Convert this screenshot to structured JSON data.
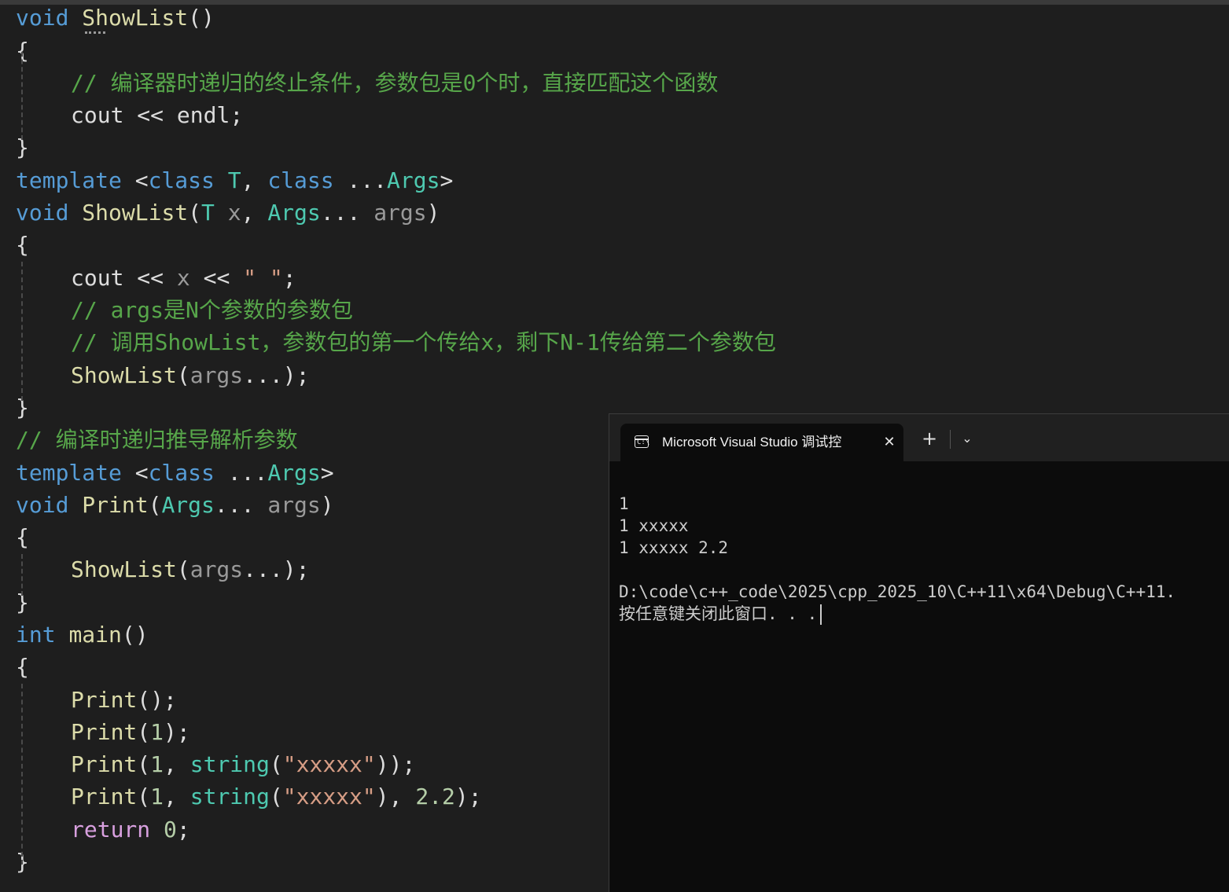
{
  "editor": {
    "lines": [
      [
        "void",
        " ",
        "ShowList",
        "()"
      ],
      [
        "{"
      ],
      [
        "// 编译器时递归的终止条件，参数包是0个时，直接匹配这个函数"
      ],
      [
        "cout",
        " << ",
        "endl",
        ";"
      ],
      [
        "}"
      ],
      [
        "template",
        " <",
        "class",
        " ",
        "T",
        ", ",
        "class",
        " ...",
        "Args",
        ">"
      ],
      [
        "void",
        " ",
        "ShowList",
        "(",
        "T",
        " ",
        "x",
        ", ",
        "Args",
        "... ",
        "args",
        ")"
      ],
      [
        "{"
      ],
      [
        "cout",
        " << ",
        "x",
        " << ",
        "\" \"",
        ";"
      ],
      [
        "// args是N个参数的参数包"
      ],
      [
        "// 调用ShowList，参数包的第一个传给x，剩下N-1传给第二个参数包"
      ],
      [
        "ShowList",
        "(",
        "args",
        "...",
        ");"
      ],
      [
        "}"
      ],
      [
        "// 编译时递归推导解析参数"
      ],
      [
        "template",
        " <",
        "class",
        " ...",
        "Args",
        ">"
      ],
      [
        "void",
        " ",
        "Print",
        "(",
        "Args",
        "... ",
        "args",
        ")"
      ],
      [
        "{"
      ],
      [
        "ShowList",
        "(",
        "args",
        "...",
        ");"
      ],
      [
        "}"
      ],
      [
        "int",
        " ",
        "main",
        "()"
      ],
      [
        "{"
      ],
      [
        "Print",
        "();"
      ],
      [
        "Print",
        "(",
        "1",
        ");"
      ],
      [
        "Print",
        "(",
        "1",
        ", ",
        "string",
        "(",
        "\"xxxxx\"",
        "));"
      ],
      [
        "Print",
        "(",
        "1",
        ", ",
        "string",
        "(",
        "\"xxxxx\"",
        "), ",
        "2.2",
        ");"
      ],
      [
        "return",
        " ",
        "0",
        ";"
      ],
      [
        "}"
      ]
    ]
  },
  "terminal": {
    "tab_title": "Microsoft Visual Studio 调试控",
    "tab_icon_glyph": "C:\\",
    "close_glyph": "✕",
    "new_tab_glyph": "+",
    "dropdown_glyph": "⌄",
    "output": [
      "1",
      "1 xxxxx",
      "1 xxxxx 2.2",
      "",
      "D:\\code\\c++_code\\2025\\cpp_2025_10\\C++11\\x64\\Debug\\C++11.",
      "按任意键关闭此窗口. . ."
    ]
  }
}
